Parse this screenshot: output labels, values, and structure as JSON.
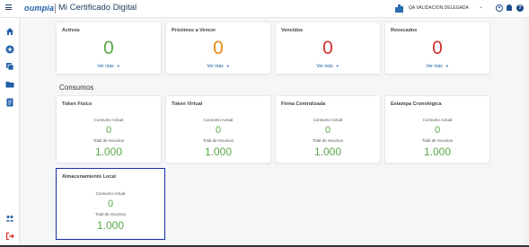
{
  "header": {
    "logo": "oumpia",
    "title": "Mi Certificado Digital",
    "org": "QA VALIDACION DELEGADA",
    "help": "?"
  },
  "status_cards": [
    {
      "title": "Activos",
      "value": "0",
      "link": "Ver más",
      "color": "#5aa84a"
    },
    {
      "title": "Próximos a Vencer",
      "value": "0",
      "link": "Ver más",
      "color": "#ec8a15"
    },
    {
      "title": "Vencidos",
      "value": "0",
      "link": "Ver más",
      "color": "#d0312d"
    },
    {
      "title": "Revocados",
      "value": "0",
      "link": "Ver más",
      "color": "#d0312d"
    }
  ],
  "consumos": {
    "section_title": "Consumos",
    "cards": [
      {
        "title": "Token Físico",
        "current_label": "Consumo Actual",
        "current": "0",
        "total_label": "Total de recursos",
        "total": "1.000"
      },
      {
        "title": "Token Virtual",
        "current_label": "Consumo Actual",
        "current": "0",
        "total_label": "Total de recursos",
        "total": "1.000"
      },
      {
        "title": "Firma Centralizada",
        "current_label": "Consumo Actual",
        "current": "0",
        "total_label": "Total de recursos",
        "total": "1.000"
      },
      {
        "title": "Estampa Cronológica",
        "current_label": "Consumo Actual",
        "current": "0",
        "total_label": "Total de recursos",
        "total": "1.000"
      },
      {
        "title": "Almacenamiento Local",
        "current_label": "Consumo Actual",
        "current": "0",
        "total_label": "Total de recursos",
        "total": "1.000"
      }
    ]
  },
  "sidebar_icons": [
    "home-icon",
    "add-circle-icon",
    "certificates-icon",
    "folder-icon",
    "document-icon",
    "users-icon",
    "logout-icon"
  ],
  "colors": {
    "brand": "#1f5ea8",
    "green": "#5aa84a",
    "orange": "#ec8a15",
    "red": "#d0312d",
    "highlight": "#1c2fa8"
  }
}
